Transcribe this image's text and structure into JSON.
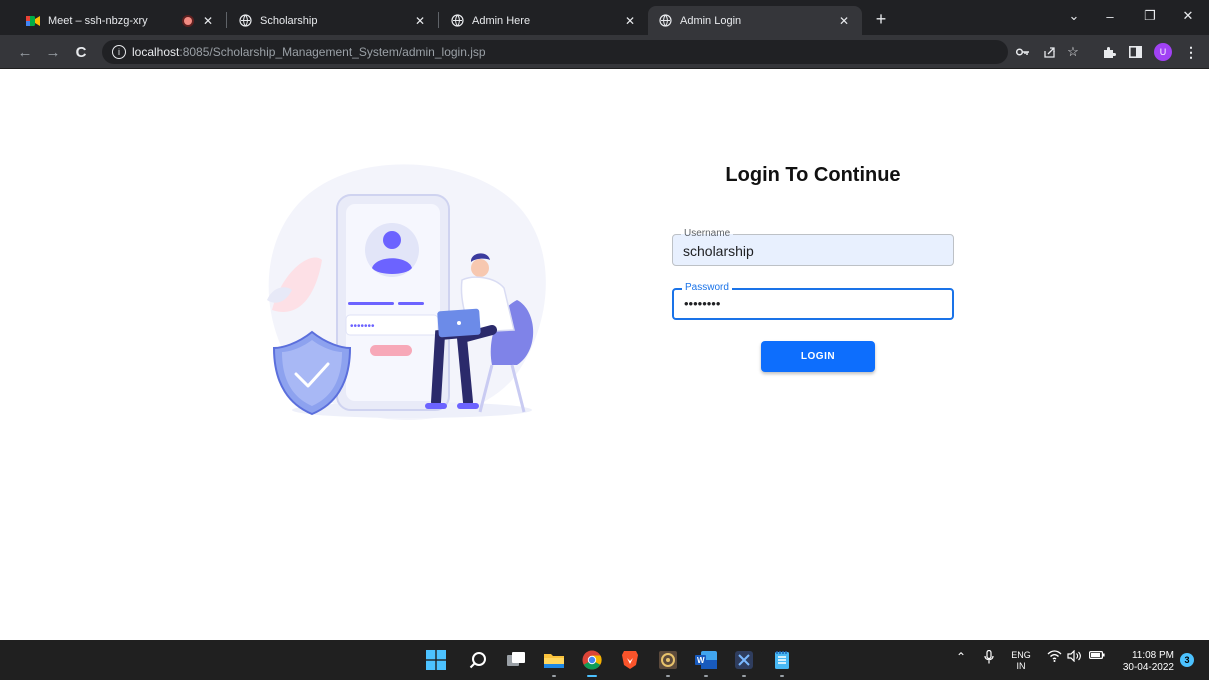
{
  "browser": {
    "tabs": [
      {
        "title": "Meet – ssh-nbzg-xry",
        "recording": true
      },
      {
        "title": "Scholarship"
      },
      {
        "title": "Admin Here"
      },
      {
        "title": "Admin Login",
        "active": true
      }
    ],
    "address": {
      "host": "localhost",
      "path": ":8085/Scholarship_Management_System/admin_login.jsp"
    },
    "profile_initial": "U"
  },
  "page": {
    "title": "Login To Continue",
    "username": {
      "label": "Username",
      "value": "scholarship"
    },
    "password": {
      "label": "Password",
      "value": "••••••••"
    },
    "login_button": "LOGIN",
    "illustration_dots": "•••••••"
  },
  "taskbar": {
    "language": {
      "line1": "ENG",
      "line2": "IN"
    },
    "time": "11:08 PM",
    "date": "30-04-2022",
    "notifications": "3"
  },
  "colors": {
    "accent": "#0d6efd",
    "focus": "#1a73e8",
    "autofill": "#e8f0fe",
    "chrome_dark": "#202124"
  }
}
